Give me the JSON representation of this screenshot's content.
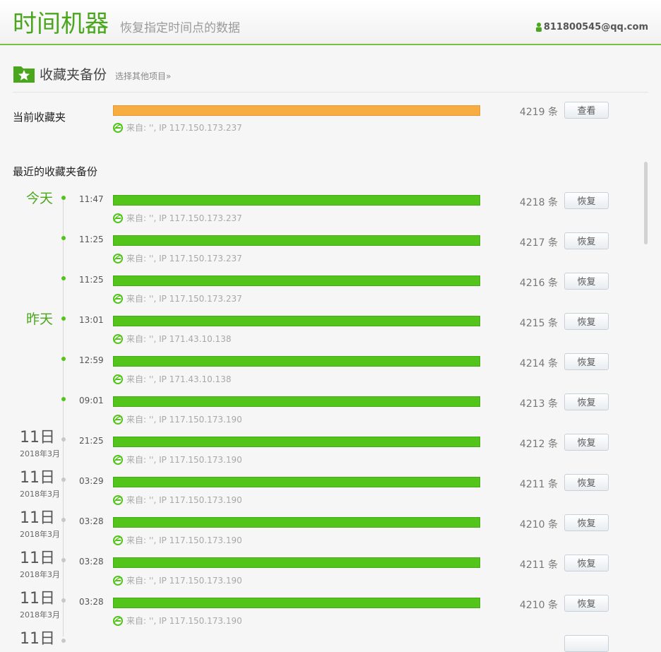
{
  "header": {
    "title": "时间机器",
    "subtitle": "恢复指定时间点的数据",
    "user_email": "811800545@qq.com"
  },
  "section": {
    "title": "收藏夹备份",
    "link": "选择其他项目»"
  },
  "current": {
    "label": "当前收藏夹",
    "source": "来自: '', IP 117.150.173.237",
    "count": "4219 条",
    "button": "查看"
  },
  "recent": {
    "label": "最近的收藏夹备份",
    "items": [
      {
        "day_label": "今天",
        "time": "11:47",
        "source": "来自: '', IP 117.150.173.237",
        "count": "4218 条",
        "button": "恢复"
      },
      {
        "time": "11:25",
        "source": "来自: '', IP 117.150.173.237",
        "count": "4217 条",
        "button": "恢复"
      },
      {
        "time": "11:25",
        "source": "来自: '', IP 117.150.173.237",
        "count": "4216 条",
        "button": "恢复"
      },
      {
        "day_label": "昨天",
        "time": "13:01",
        "source": "来自: '', IP 171.43.10.138",
        "count": "4215 条",
        "button": "恢复"
      },
      {
        "time": "12:59",
        "source": "来自: '', IP 171.43.10.138",
        "count": "4214 条",
        "button": "恢复"
      },
      {
        "time": "09:01",
        "source": "来自: '', IP 117.150.173.190",
        "count": "4213 条",
        "button": "恢复"
      },
      {
        "date_day": "11日",
        "date_month": "2018年3月",
        "time": "21:25",
        "source": "来自: '', IP 117.150.173.190",
        "count": "4212 条",
        "button": "恢复"
      },
      {
        "date_day": "11日",
        "date_month": "2018年3月",
        "time": "03:29",
        "source": "来自: '', IP 117.150.173.190",
        "count": "4211 条",
        "button": "恢复"
      },
      {
        "date_day": "11日",
        "date_month": "2018年3月",
        "time": "03:28",
        "source": "来自: '', IP 117.150.173.190",
        "count": "4210 条",
        "button": "恢复"
      },
      {
        "date_day": "11日",
        "date_month": "2018年3月",
        "time": "03:28",
        "source": "来自: '', IP 117.150.173.190",
        "count": "4211 条",
        "button": "恢复"
      },
      {
        "date_day": "11日",
        "date_month": "2018年3月",
        "time": "03:28",
        "source": "来自: '', IP 117.150.173.190",
        "count": "4210 条",
        "button": "恢复"
      },
      {
        "date_day": "11日",
        "date_month": "",
        "time": "",
        "source": "",
        "count": "",
        "button": ""
      }
    ]
  },
  "colors": {
    "accent": "#4aa71d",
    "bar_green": "#52c41a",
    "bar_orange": "#f8ad42"
  },
  "icons": {
    "user": "user-icon",
    "folder": "favorites-folder-icon",
    "source": "ie-browser-icon"
  }
}
